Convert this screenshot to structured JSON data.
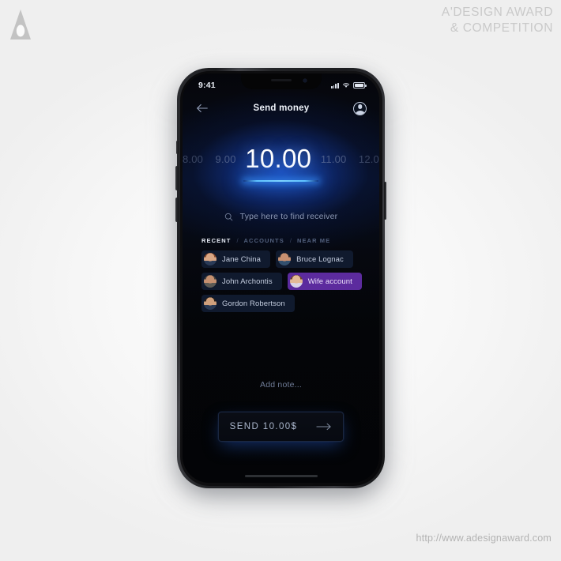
{
  "branding": {
    "logo_icon": "adesign-triangle-logo-icon",
    "title_line1": "A'DESIGN AWARD",
    "title_line2": "& COMPETITION",
    "url": "http://www.adesignaward.com"
  },
  "phone": {
    "status_bar": {
      "time": "9:41",
      "signal_icon": "signal-bars-icon",
      "wifi_icon": "wifi-icon",
      "battery_icon": "battery-full-icon"
    },
    "header": {
      "back_icon": "back-arrow-icon",
      "title": "Send money",
      "avatar_icon": "profile-avatar-icon"
    },
    "amount_picker": {
      "selected": "10.00",
      "prev_far": "8.00",
      "prev": "9.00",
      "next": "11.00",
      "next_far": "12.0",
      "accent_color": "#5fc3ff"
    },
    "search": {
      "icon": "search-icon",
      "placeholder": "Type here to find receiver",
      "value": ""
    },
    "tabs": [
      {
        "label": "RECENT",
        "active": true
      },
      {
        "label": "ACCOUNTS",
        "active": false
      },
      {
        "label": "NEAR ME",
        "active": false
      }
    ],
    "tab_separator": "/",
    "contacts": [
      {
        "name": "Jane China",
        "selected": false,
        "skin": "#d9a684",
        "hair": "#8c4a2a",
        "cloth": "#2b3b58"
      },
      {
        "name": "Bruce Lognac",
        "selected": false,
        "skin": "#c89070",
        "hair": "#20242c",
        "cloth": "#33506e"
      },
      {
        "name": "John Archontis",
        "selected": false,
        "skin": "#c59070",
        "hair": "#4a4640",
        "cloth": "#5c5a55"
      },
      {
        "name": "Wife account",
        "selected": true,
        "skin": "#e3b896",
        "hair": "#6e4527",
        "cloth": "#d9d3e8"
      },
      {
        "name": "Gordon Robertson",
        "selected": false,
        "skin": "#d0a07c",
        "hair": "#2b2118",
        "cloth": "#2a3a55"
      }
    ],
    "selected_chip_color": "#5c2b9e",
    "note": {
      "placeholder": "Add note...",
      "value": ""
    },
    "send_button": {
      "label": "SEND 10.00$",
      "arrow_icon": "arrow-right-icon"
    },
    "home_indicator": "home-indicator"
  }
}
